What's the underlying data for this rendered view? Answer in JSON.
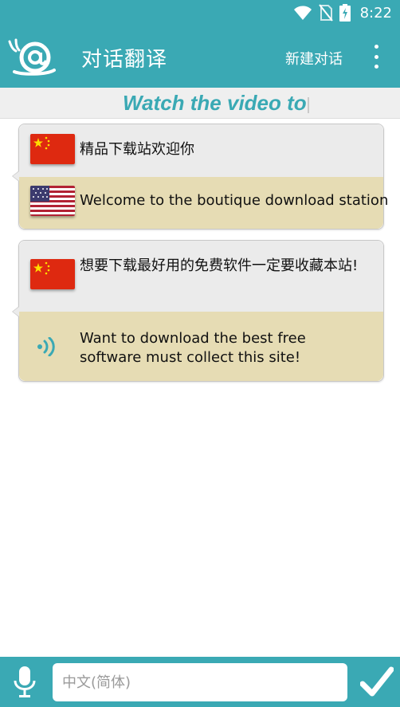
{
  "status_bar": {
    "time": "8:22",
    "icons": [
      "wifi-icon",
      "no-sim-icon",
      "battery-charging-icon"
    ]
  },
  "app_bar": {
    "logo": "snail-at-logo",
    "title": "对话翻译",
    "new_conversation_label": "新建对话",
    "overflow_icon": "more-vert-icon"
  },
  "banner": {
    "text": "Watch the video to"
  },
  "conversation": [
    {
      "source_flag": "china-flag-icon",
      "source_text": "精品下载站欢迎你",
      "target_flag": "usa-flag-icon",
      "target_text": "Welcome to the boutique download station"
    },
    {
      "source_flag": "china-flag-icon",
      "source_text": "想要下载最好用的免费软件一定要收藏本站!",
      "target_icon": "speaker-icon",
      "target_text": "Want to download the best free software must collect this site!"
    }
  ],
  "bottom_bar": {
    "mic_icon": "microphone-icon",
    "input_value": "",
    "input_placeholder": "中文(简体)",
    "send_icon": "checkmark-icon"
  },
  "colors": {
    "primary": "#3aa9b4",
    "source_bubble": "#ebebeb",
    "target_bubble": "#e6dcb4",
    "banner_bg": "#efefef"
  }
}
